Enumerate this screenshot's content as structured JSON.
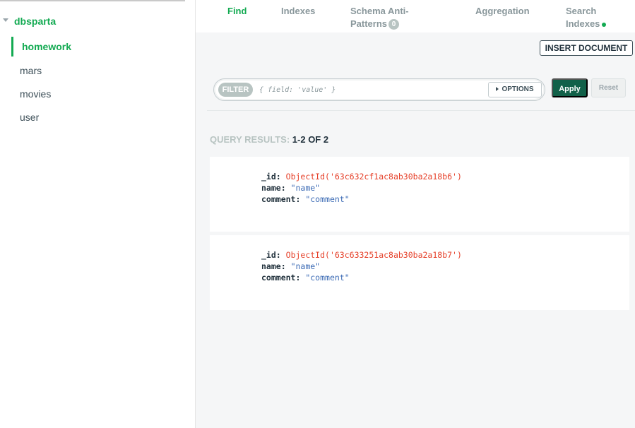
{
  "sidebar": {
    "database": "dbsparta",
    "collections": [
      {
        "label": "homework",
        "active": true
      },
      {
        "label": "mars",
        "active": false
      },
      {
        "label": "movies",
        "active": false
      },
      {
        "label": "user",
        "active": false
      }
    ]
  },
  "tabs": {
    "find": "Find",
    "indexes": "Indexes",
    "schema_line1": "Schema Anti-",
    "schema_line2": "Patterns",
    "schema_badge": "0",
    "aggregation": "Aggregation",
    "search_line1": "Search",
    "search_line2": "Indexes"
  },
  "toolbar": {
    "insert_label": "INSERT DOCUMENT",
    "filter_label": "FILTER",
    "filter_placeholder": "{ field: 'value' }",
    "options_label": "OPTIONS",
    "apply_label": "Apply",
    "reset_label": "Reset"
  },
  "results": {
    "prefix": "QUERY RESULTS:",
    "range": "1-2 OF 2",
    "documents": [
      {
        "id_key": "_id:",
        "id_value": "ObjectId('63c632cf1ac8ab30ba2a18b6')",
        "name_key": "name:",
        "name_value": "\"name\"",
        "comment_key": "comment:",
        "comment_value": "\"comment\""
      },
      {
        "id_key": "_id:",
        "id_value": "ObjectId('63c633251ac8ab30ba2a18b7')",
        "name_key": "name:",
        "name_value": "\"name\"",
        "comment_key": "comment:",
        "comment_value": "\"comment\""
      }
    ]
  },
  "colors": {
    "accent": "#13aa52",
    "apply": "#116149",
    "object_id": "#e6412a",
    "string": "#3c6bb5"
  }
}
